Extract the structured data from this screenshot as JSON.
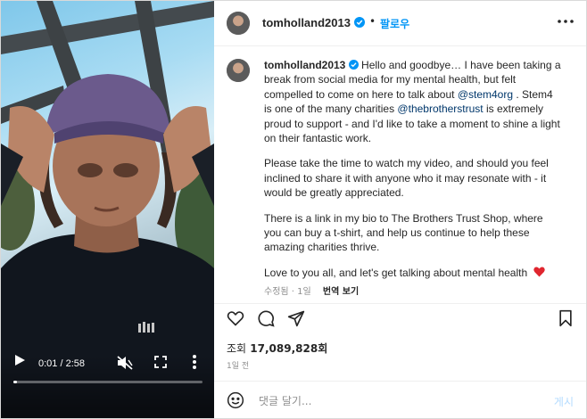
{
  "post": {
    "username": "tomholland2013",
    "follow_label": "팔로우",
    "dot": "•",
    "caption": {
      "intro": "Hello and goodbye… I have been taking a break from social media for my mental health, but felt compelled to come on here to talk about",
      "mention1": "@stem4org",
      "mid": ". Stem4 is one of the many charities",
      "mention2": "@thebrotherstrust",
      "end": "is extremely proud to support - and I'd like to take a moment to shine a light on their fantastic work.",
      "p2": "Please take the time to watch my video, and should you feel inclined to share it with anyone who it may resonate with - it would be greatly appreciated.",
      "p3": "There is a link in my bio to The Brothers Trust Shop, where you can buy a t-shirt, and help us continue to help these amazing charities thrive.",
      "p4": "Love to you all, and let's get talking about mental health",
      "heart_emoji": "❤️"
    },
    "edited_label": "수정됨 · 1일",
    "translate_label": "번역 보기",
    "views_label": "조회",
    "views_count": "17,089,828회",
    "age": "1일 전",
    "comment_placeholder": "댓글 달기...",
    "post_label": "게시"
  },
  "video": {
    "current_time": "0:01",
    "duration": "2:58",
    "time_sep": " / ",
    "progress": 0.006
  },
  "colors": {
    "link": "#00376b",
    "follow": "#0095f6",
    "verified": "#0095f6",
    "heart": "#e0262f"
  }
}
